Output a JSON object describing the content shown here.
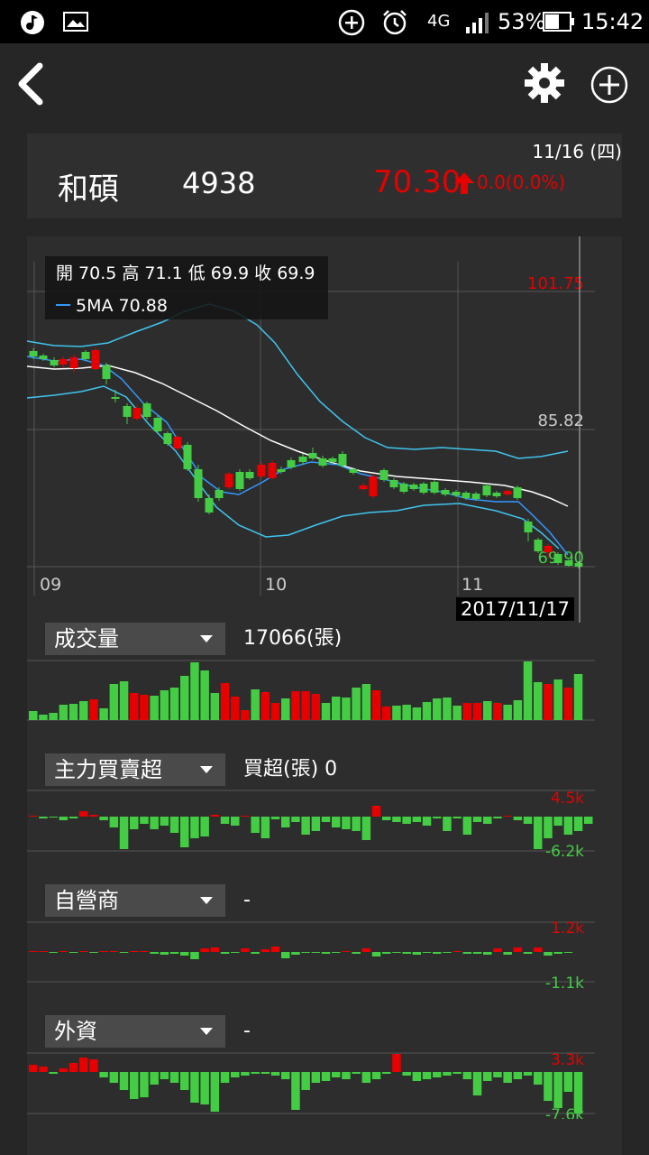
{
  "status_bar": {
    "battery_percent": "53%",
    "network": "4G",
    "time": "15:42"
  },
  "stock": {
    "name": "和碩",
    "code": "4938",
    "price": "70.30",
    "change": "0.0(0.0%)",
    "date": "11/16 (四)"
  },
  "ohlc_legend": {
    "ohlc_text": "開 70.5 高 71.1 低 69.9 收 69.9",
    "ma_text": "5MA 70.88"
  },
  "price_chart": {
    "y_labels": [
      "101.75",
      "85.82",
      "69.90"
    ],
    "x_labels": [
      "09",
      "10",
      "11"
    ],
    "cursor_date": "2017/11/17"
  },
  "sections": {
    "volume": {
      "label": "成交量",
      "value": "17066(張)"
    },
    "main_force": {
      "label": "主力買賣超",
      "value": "買超(張) 0",
      "top": "4.5k",
      "bottom": "-6.2k"
    },
    "dealer": {
      "label": "自營商",
      "value": "-",
      "top": "1.2k",
      "bottom": "-1.1k"
    },
    "foreign": {
      "label": "外資",
      "value": "-",
      "top": "3.3k",
      "bottom": "-7.6k"
    }
  },
  "colors": {
    "up": "#e60000",
    "down": "#44cc44",
    "ma": "#3399ff",
    "band": "#40c4ee",
    "mid": "#ffffff"
  },
  "icons": [
    "back-arrow-icon",
    "gear-icon",
    "add-circle-icon",
    "music-note-icon",
    "image-icon",
    "alarm-icon",
    "signal-icon",
    "battery-icon"
  ],
  "chart_data": {
    "type": "candlestick",
    "candles": [
      {
        "o": 70.5,
        "h": 71.1,
        "l": 69.9,
        "c": 69.9
      }
    ],
    "volume_shown": "17066(張)"
  }
}
